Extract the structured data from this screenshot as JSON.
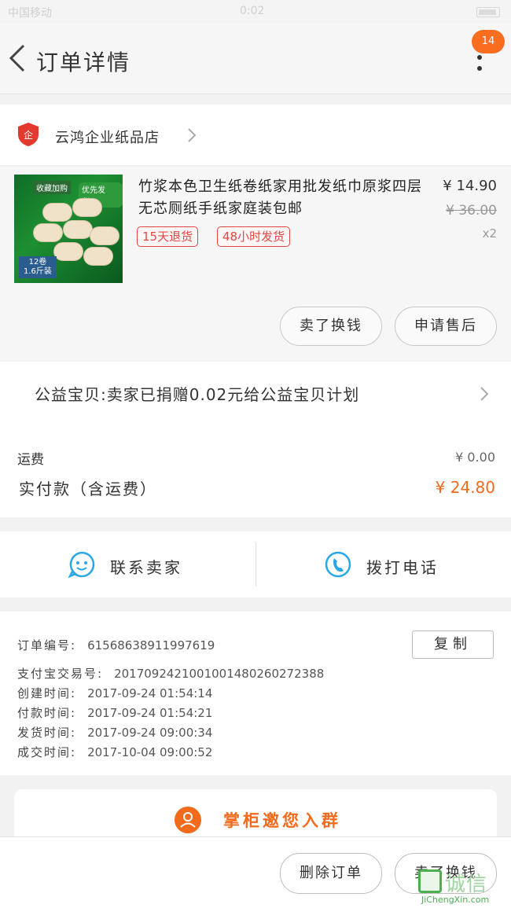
{
  "status_bar": {
    "carrier": "中国移动",
    "time": "0:02"
  },
  "header": {
    "title": "订单详情",
    "badge": "14"
  },
  "shop": {
    "name": "云鸿企业纸品店"
  },
  "product": {
    "title": "竹浆本色卫生纸卷纸家用批发纸巾原浆四层无芯厕纸手纸家庭装包邮",
    "image_tag1": "收藏加购",
    "image_tag2": "优先发货！",
    "image_pack": "12卷\n1.6斤装",
    "tags": [
      "15天退货",
      "48小时发货"
    ],
    "price": "¥ 14.90",
    "original_price": "¥ 36.00",
    "quantity": "x2"
  },
  "product_actions": {
    "resell": "卖了换钱",
    "after_sale": "申请售后"
  },
  "charity": {
    "text": "公益宝贝:卖家已捐赠0.02元给公益宝贝计划"
  },
  "amounts": {
    "shipping_label": "运费",
    "shipping_value": "¥ 0.00",
    "paid_label": "实付款（含运费）",
    "paid_value": "¥ 24.80"
  },
  "contact": {
    "chat_label": "联系卖家",
    "call_label": "拨打电话"
  },
  "order_info": {
    "copy_label": "复制",
    "rows": [
      {
        "key": "订单编号:",
        "value": "61568638911997619"
      },
      {
        "key": "支付宝交易号:",
        "value": "2017092421001001480260272388"
      },
      {
        "key": "创建时间:",
        "value": "2017-09-24 01:54:14"
      },
      {
        "key": "付款时间:",
        "value": "2017-09-24 01:54:21"
      },
      {
        "key": "发货时间:",
        "value": "2017-09-24 09:00:34"
      },
      {
        "key": "成交时间:",
        "value": "2017-10-04 09:00:52"
      }
    ]
  },
  "group": {
    "label": "掌柜邀您入群"
  },
  "bottom_bar": {
    "delete_label": "删除订单",
    "resell_label": "卖了换钱"
  },
  "watermark": {
    "text": "诚信",
    "url": "JiChengXin.com"
  },
  "colors": {
    "accent": "#f26b1d",
    "tag_red": "#e64545",
    "icon_blue": "#2aa7e6"
  }
}
